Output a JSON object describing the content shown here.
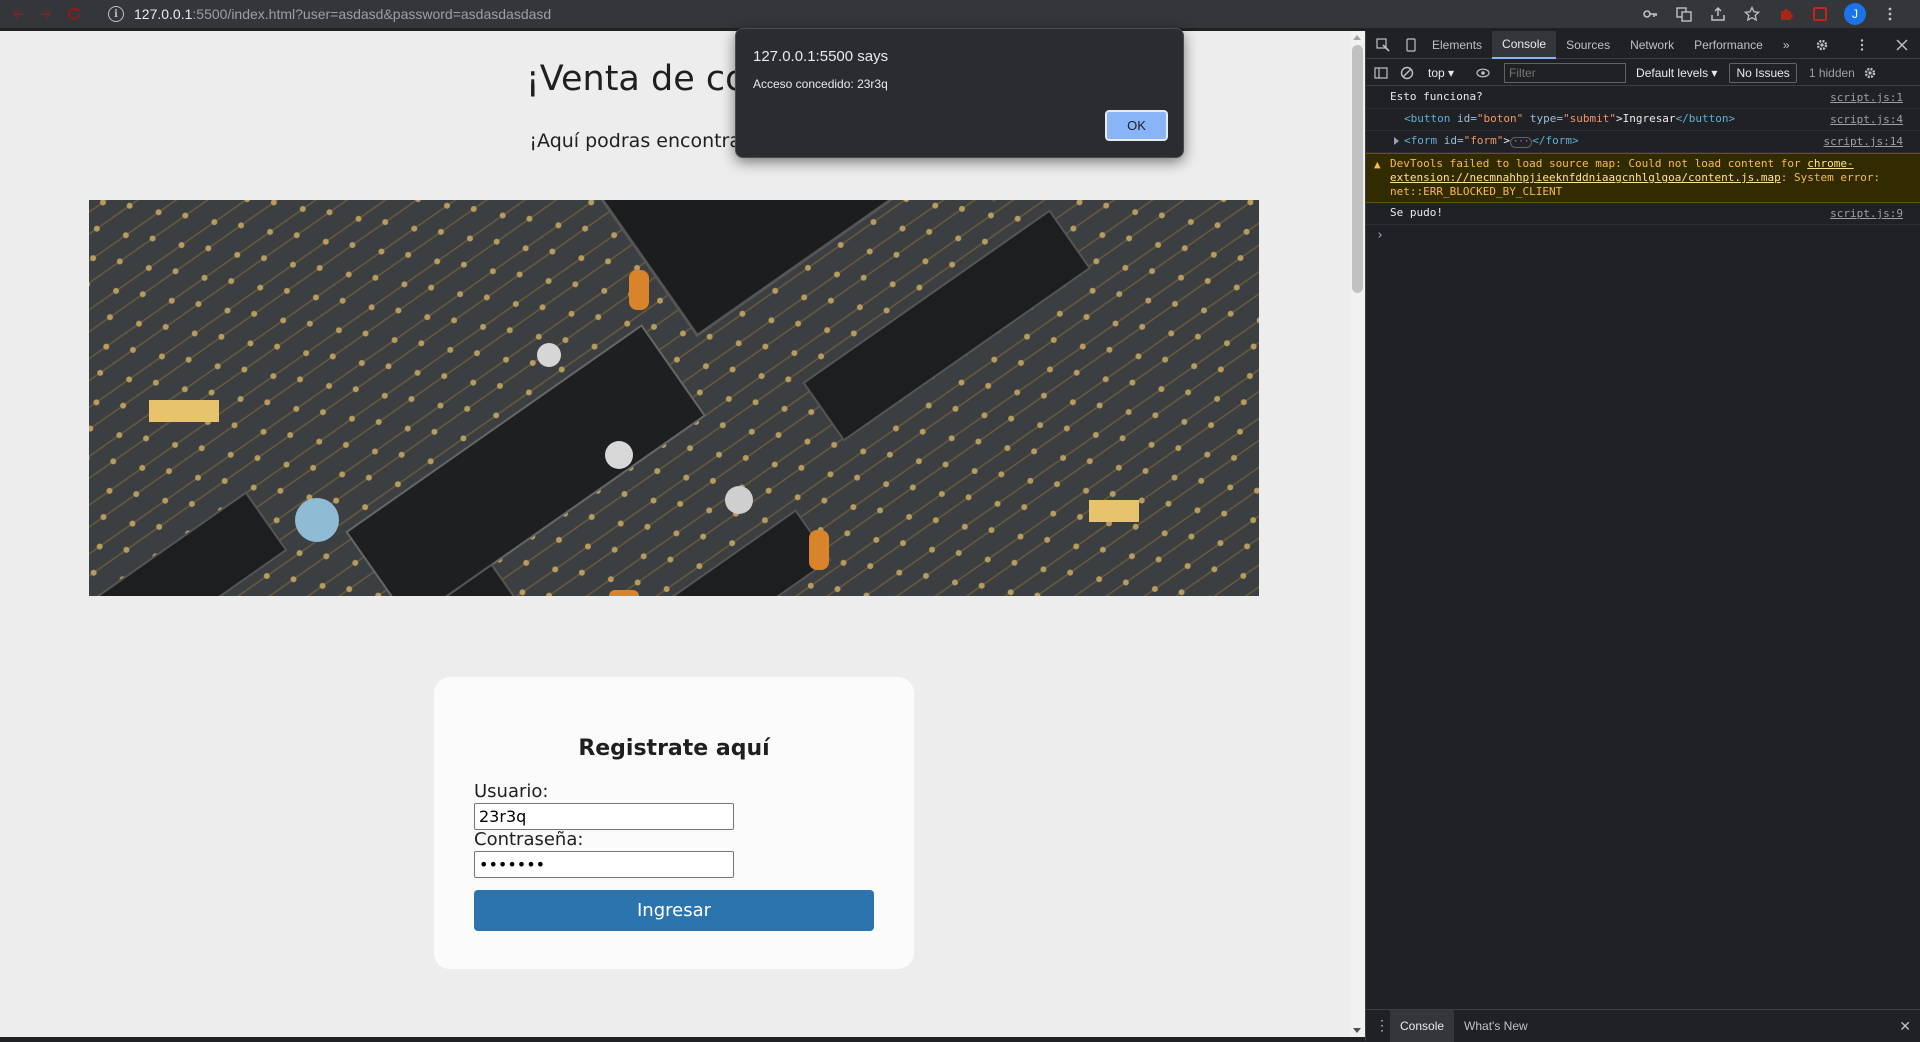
{
  "browser": {
    "url_host": "127.0.0.1",
    "url_path": ":5500/index.html?user=asdasd&password=asdasdasdasd",
    "avatar_letter": "J"
  },
  "page": {
    "title": "¡Venta de compo",
    "subtitle": "¡Aquí podras encontrar todo lo",
    "form": {
      "title": "Registrate aquí",
      "user_label": "Usuario:",
      "user_value": "23r3q",
      "pass_label": "Contraseña:",
      "pass_value": "•••••••",
      "submit_label": "Ingresar",
      "button_color": "#2c74ad"
    }
  },
  "dialog": {
    "title": "127.0.0.1:5500 says",
    "message": "Acceso concedido: 23r3q",
    "ok_label": "OK"
  },
  "devtools": {
    "tabs": [
      "Elements",
      "Console",
      "Sources",
      "Network",
      "Performance"
    ],
    "active_tab": "Console",
    "context": "top",
    "filter_placeholder": "Filter",
    "levels": "Default levels",
    "issues": "No Issues",
    "hidden": "1 hidden",
    "console": {
      "log1": {
        "text": "Esto funciona?",
        "src": "script.js:1"
      },
      "log2": {
        "tag_open": "<button",
        "attr1": "id=",
        "val1": "\"boton\"",
        "attr2": "type=",
        "val2": "\"submit\"",
        "text": ">Ingresar",
        "tag_close": "</button>",
        "src": "script.js:4"
      },
      "log3": {
        "tag_open": "<form",
        "attr1": "id=",
        "val1": "\"form\"",
        "text": ">",
        "ellipsis": "···",
        "tag_close": "</form>",
        "src": "script.js:14"
      },
      "warn": {
        "prefix": "DevTools failed to load source map: Could not load content for ",
        "link": "chrome-extension://necmnahhpjieeknfddniaagcnhlglgoa/content.js.map",
        "suffix": ": System error: net::ERR_BLOCKED_BY_CLIENT"
      },
      "log4": {
        "text": "Se pudo!",
        "src": "script.js:9"
      },
      "prompt": "›"
    },
    "drawer_tabs": [
      "Console",
      "What's New"
    ]
  },
  "colors": {
    "alert_ok": "#8ab4f8",
    "warn_text": "#f9bc4b"
  }
}
